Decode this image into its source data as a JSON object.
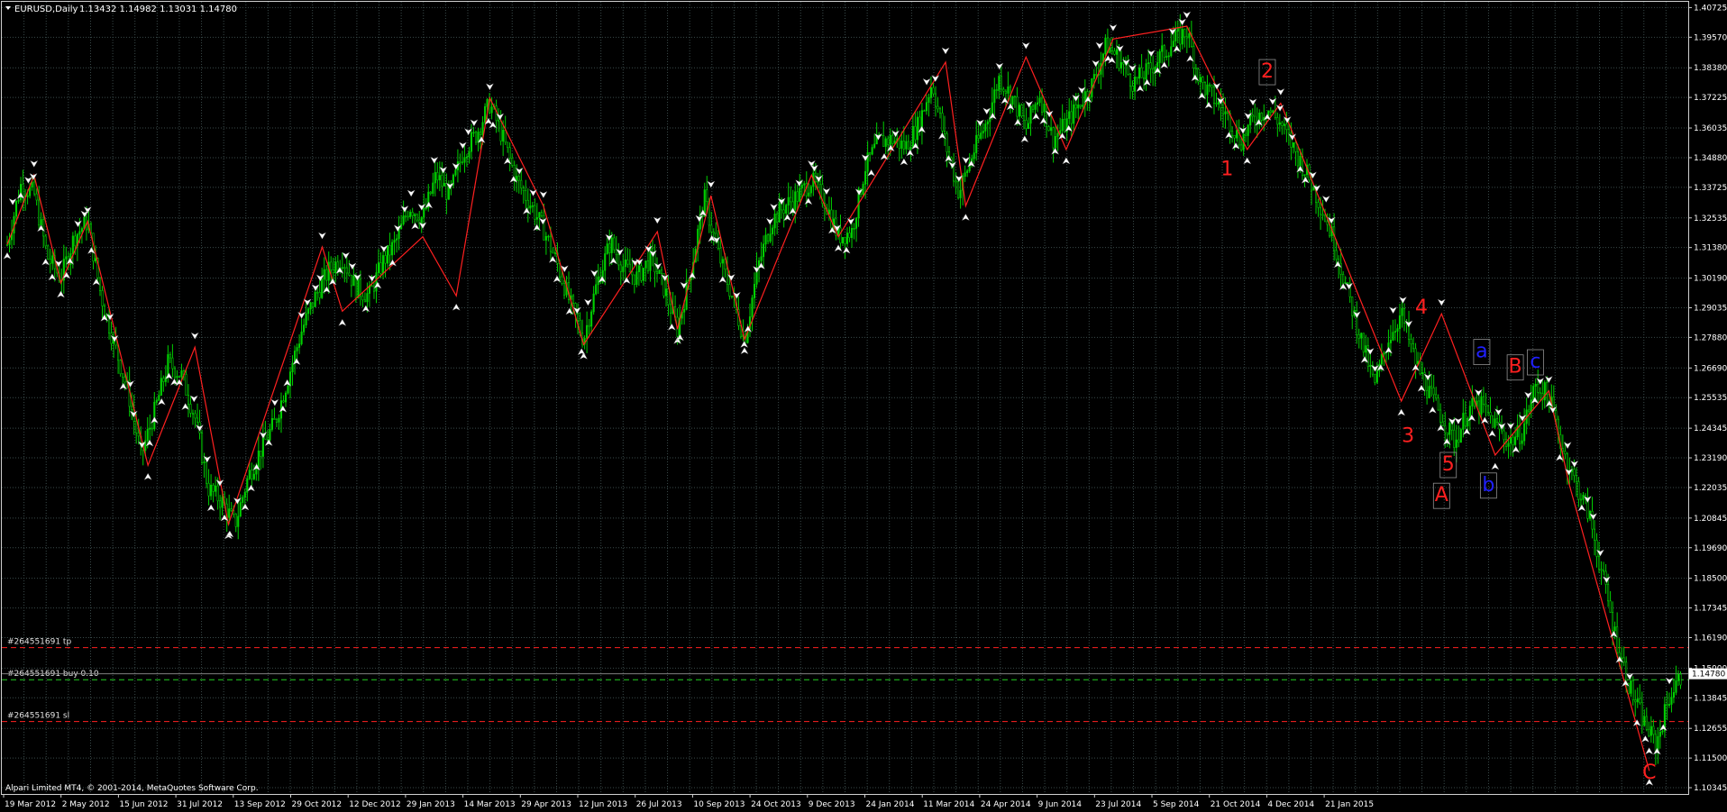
{
  "header": {
    "symbol": "EURUSD,Daily",
    "ohlc": "1.13432 1.14982 1.13031 1.14780"
  },
  "footer": {
    "copyright": "Alpari Limited MT4, © 2001-2014, MetaQuotes Software Corp."
  },
  "orders": [
    {
      "label": "#264551691 tp",
      "price": 1.158,
      "color": "#ff2020"
    },
    {
      "label": "#264551691 buy 0.10",
      "price": 1.1455,
      "color": "#20d020"
    },
    {
      "label": "#264551691 sl",
      "price": 1.1292,
      "color": "#ff2020"
    }
  ],
  "current_price": "1.14780",
  "colors": {
    "background": "#000000",
    "grid": "#3a4a4a",
    "candles": "#00d000",
    "zigzag": "#ff2020",
    "wave_primary": "#ff2020",
    "wave_secondary": "#2020ff",
    "axis_text": "#ffffff",
    "fractal_marker": "#ffffff"
  },
  "chart_data": {
    "type": "line",
    "title": "EURUSD,Daily",
    "ylim": [
      1.101,
      1.4095
    ],
    "y_ticks": [
      "1.40725",
      "1.39570",
      "1.38380",
      "1.37225",
      "1.36035",
      "1.34880",
      "1.33725",
      "1.32535",
      "1.31380",
      "1.30190",
      "1.29035",
      "1.27880",
      "1.26690",
      "1.25535",
      "1.24345",
      "1.23190",
      "1.22035",
      "1.20845",
      "1.19690",
      "1.18500",
      "1.17345",
      "1.16190",
      "1.15000",
      "1.13845",
      "1.12655",
      "1.11500",
      "1.10345"
    ],
    "x_ticks": [
      "19 Mar 2012",
      "2 May 2012",
      "15 Jun 2012",
      "31 Jul 2012",
      "13 Sep 2012",
      "29 Oct 2012",
      "12 Dec 2012",
      "29 Jan 2013",
      "14 Mar 2013",
      "29 Apr 2013",
      "12 Jun 2013",
      "26 Jul 2013",
      "10 Sep 2013",
      "24 Oct 2013",
      "9 Dec 2013",
      "24 Jan 2014",
      "11 Mar 2014",
      "24 Apr 2014",
      "9 Jun 2014",
      "23 Jul 2014",
      "5 Sep 2014",
      "21 Oct 2014",
      "4 Dec 2014",
      "21 Jan 2015"
    ],
    "grid": true,
    "price_path": [
      [
        0,
        1.315
      ],
      [
        2,
        1.338
      ],
      [
        4,
        1.335
      ],
      [
        6,
        1.31
      ],
      [
        8,
        1.302
      ],
      [
        10,
        1.318
      ],
      [
        12,
        1.324
      ],
      [
        14,
        1.295
      ],
      [
        16,
        1.276
      ],
      [
        18,
        1.258
      ],
      [
        20,
        1.233
      ],
      [
        22,
        1.25
      ],
      [
        24,
        1.269
      ],
      [
        26,
        1.264
      ],
      [
        28,
        1.248
      ],
      [
        30,
        1.22
      ],
      [
        32,
        1.215
      ],
      [
        34,
        1.206
      ],
      [
        36,
        1.225
      ],
      [
        38,
        1.236
      ],
      [
        40,
        1.246
      ],
      [
        42,
        1.264
      ],
      [
        44,
        1.282
      ],
      [
        46,
        1.295
      ],
      [
        48,
        1.305
      ],
      [
        50,
        1.31
      ],
      [
        52,
        1.298
      ],
      [
        54,
        1.295
      ],
      [
        56,
        1.308
      ],
      [
        58,
        1.316
      ],
      [
        60,
        1.33
      ],
      [
        62,
        1.325
      ],
      [
        64,
        1.342
      ],
      [
        66,
        1.334
      ],
      [
        68,
        1.351
      ],
      [
        70,
        1.358
      ],
      [
        72,
        1.37
      ],
      [
        74,
        1.356
      ],
      [
        76,
        1.34
      ],
      [
        78,
        1.331
      ],
      [
        80,
        1.321
      ],
      [
        82,
        1.308
      ],
      [
        84,
        1.292
      ],
      [
        86,
        1.278
      ],
      [
        88,
        1.3
      ],
      [
        90,
        1.316
      ],
      [
        92,
        1.306
      ],
      [
        94,
        1.302
      ],
      [
        96,
        1.31
      ],
      [
        98,
        1.298
      ],
      [
        100,
        1.282
      ],
      [
        102,
        1.305
      ],
      [
        104,
        1.333
      ],
      [
        106,
        1.312
      ],
      [
        108,
        1.296
      ],
      [
        110,
        1.278
      ],
      [
        112,
        1.306
      ],
      [
        114,
        1.324
      ],
      [
        116,
        1.33
      ],
      [
        118,
        1.334
      ],
      [
        120,
        1.34
      ],
      [
        122,
        1.332
      ],
      [
        124,
        1.318
      ],
      [
        126,
        1.32
      ],
      [
        128,
        1.345
      ],
      [
        130,
        1.355
      ],
      [
        132,
        1.356
      ],
      [
        134,
        1.353
      ],
      [
        136,
        1.362
      ],
      [
        138,
        1.378
      ],
      [
        140,
        1.354
      ],
      [
        142,
        1.335
      ],
      [
        144,
        1.35
      ],
      [
        146,
        1.362
      ],
      [
        148,
        1.38
      ],
      [
        150,
        1.372
      ],
      [
        152,
        1.36
      ],
      [
        154,
        1.374
      ],
      [
        156,
        1.356
      ],
      [
        158,
        1.362
      ],
      [
        160,
        1.37
      ],
      [
        162,
        1.378
      ],
      [
        164,
        1.393
      ],
      [
        166,
        1.387
      ],
      [
        168,
        1.378
      ],
      [
        170,
        1.382
      ],
      [
        172,
        1.388
      ],
      [
        174,
        1.394
      ],
      [
        176,
        1.398
      ],
      [
        178,
        1.378
      ],
      [
        180,
        1.372
      ],
      [
        182,
        1.365
      ],
      [
        184,
        1.355
      ],
      [
        186,
        1.364
      ],
      [
        188,
        1.368
      ],
      [
        190,
        1.362
      ],
      [
        192,
        1.352
      ],
      [
        194,
        1.342
      ],
      [
        196,
        1.33
      ],
      [
        198,
        1.316
      ],
      [
        200,
        1.296
      ],
      [
        202,
        1.278
      ],
      [
        204,
        1.26
      ],
      [
        206,
        1.278
      ],
      [
        208,
        1.288
      ],
      [
        210,
        1.27
      ],
      [
        212,
        1.258
      ],
      [
        214,
        1.248
      ],
      [
        216,
        1.238
      ],
      [
        218,
        1.251
      ],
      [
        220,
        1.252
      ],
      [
        222,
        1.245
      ],
      [
        224,
        1.238
      ],
      [
        226,
        1.242
      ],
      [
        228,
        1.26
      ],
      [
        230,
        1.256
      ],
      [
        232,
        1.236
      ],
      [
        234,
        1.222
      ],
      [
        236,
        1.21
      ],
      [
        238,
        1.186
      ],
      [
        240,
        1.162
      ],
      [
        242,
        1.143
      ],
      [
        244,
        1.13
      ],
      [
        246,
        1.12
      ],
      [
        248,
        1.139
      ],
      [
        250,
        1.1478
      ]
    ],
    "zigzag": [
      [
        0,
        1.315
      ],
      [
        4,
        1.342
      ],
      [
        8,
        1.3
      ],
      [
        12,
        1.324
      ],
      [
        21,
        1.229
      ],
      [
        28,
        1.275
      ],
      [
        33,
        1.206
      ],
      [
        47,
        1.314
      ],
      [
        50,
        1.289
      ],
      [
        62,
        1.318
      ],
      [
        67,
        1.295
      ],
      [
        72,
        1.372
      ],
      [
        80,
        1.33
      ],
      [
        86,
        1.276
      ],
      [
        97,
        1.32
      ],
      [
        100,
        1.282
      ],
      [
        105,
        1.334
      ],
      [
        110,
        1.278
      ],
      [
        120,
        1.342
      ],
      [
        124,
        1.318
      ],
      [
        140,
        1.386
      ],
      [
        143,
        1.33
      ],
      [
        152,
        1.388
      ],
      [
        158,
        1.352
      ],
      [
        165,
        1.395
      ],
      [
        176,
        1.4
      ],
      [
        185,
        1.352
      ],
      [
        190,
        1.37
      ],
      [
        208,
        1.254
      ],
      [
        214,
        1.288
      ],
      [
        222,
        1.233
      ],
      [
        230,
        1.258
      ],
      [
        233,
        1.222
      ],
      [
        245,
        1.11
      ]
    ],
    "wave_labels": [
      {
        "text": "1",
        "x": 182,
        "y": 1.342,
        "color": "#ff2020"
      },
      {
        "text": "2",
        "x": 188,
        "y": 1.38,
        "color": "#ff2020"
      },
      {
        "text": "3",
        "x": 209,
        "y": 1.238,
        "color": "#ff2020"
      },
      {
        "text": "4",
        "x": 211,
        "y": 1.288,
        "color": "#ff2020"
      },
      {
        "text": "5",
        "x": 215,
        "y": 1.227,
        "color": "#ff2020"
      },
      {
        "text": "A",
        "x": 214,
        "y": 1.215,
        "color": "#ff2020"
      },
      {
        "text": "a",
        "x": 220,
        "y": 1.271,
        "color": "#2020ff"
      },
      {
        "text": "b",
        "x": 221,
        "y": 1.219,
        "color": "#2020ff"
      },
      {
        "text": "B",
        "x": 225,
        "y": 1.265,
        "color": "#ff2020"
      },
      {
        "text": "c",
        "x": 228,
        "y": 1.267,
        "color": "#2020ff"
      },
      {
        "text": "C",
        "x": 245,
        "y": 1.107,
        "color": "#ff2020"
      }
    ]
  }
}
